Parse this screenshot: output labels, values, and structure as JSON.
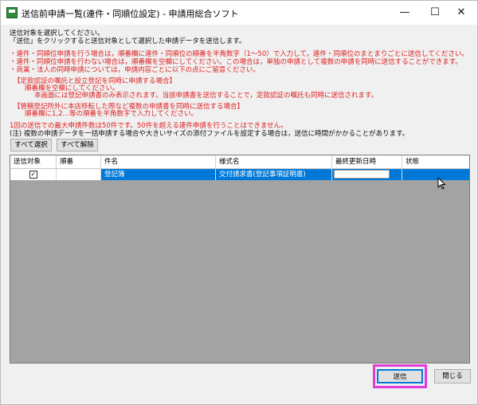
{
  "window": {
    "title": "送信前申請一覧(連件・同順位設定) - 申請用総合ソフト",
    "min_label": "—",
    "max_label": "☐",
    "close_label": "✕"
  },
  "instructions": {
    "line1": "送信対象を選択してください。",
    "line2": "「送信」をクリックすると送信対象として選択した申請データを送信します。"
  },
  "notes_red": [
    "・連件・同順位申請を行う場合は，順番欄に連件・同順位の順番を半角数字（1～50）で入力して，連件・同順位のまとまりごとに送信してください。",
    "・連件・同順位申請を行わない場合は，順番欄を空欄にしてください。この場合は，単独の申請として複数の申請を同時に送信することができます。",
    "・商業・法人の同時申請については，申請内容ごとに以下の点にご留意ください。"
  ],
  "section1": {
    "title": "【定款認証の嘱託と設立登記を同時に申請する場合】",
    "line1": "順番欄を空欄にしてください。",
    "line2": "本画面には登記申請書のみ表示されます。当該申請書を送信することで，定款認証の嘱託も同時に送信されます。"
  },
  "section2": {
    "title": "【管轄登記所外に本店移転した際など複数の申請書を同時に送信する場合】",
    "line1": "順番欄に1,2…等の順番を半角数字で入力してください。"
  },
  "limit_note": "1回の送信での最大申請件数は50件です。50件を超える連件申請を行うことはできません。",
  "caution_note": "(注) 複数の申請データを一括申請する場合や大きいサイズの添付ファイルを設定する場合は，送信に時間がかかることがあります。",
  "buttons": {
    "select_all": "すべて選択",
    "deselect_all": "すべて解除",
    "send": "送信",
    "close": "閉じる"
  },
  "table": {
    "headers": [
      "送信対象",
      "順番",
      "件名",
      "様式名",
      "最終更新日時",
      "状態"
    ],
    "rows": [
      {
        "checked": "✓",
        "order": "",
        "subject": "登記簿",
        "form": "交付請求書(登記事項証明書)",
        "updated": "",
        "status": ""
      }
    ]
  },
  "icons": {
    "app": "app-icon",
    "cursor": "mouse-pointer-icon"
  },
  "colors": {
    "warning_text": "#e02020",
    "selection": "#0078d7",
    "highlight": "#e23ad6"
  }
}
